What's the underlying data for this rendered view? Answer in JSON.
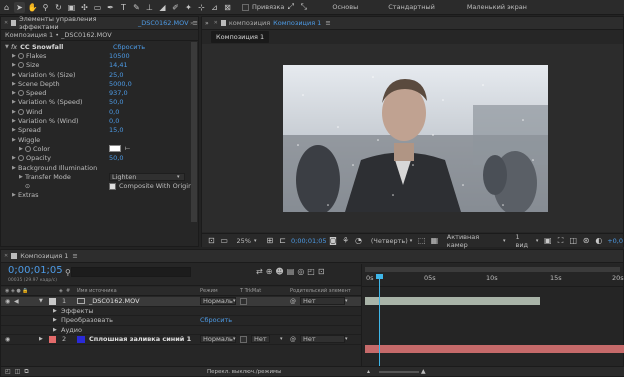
{
  "toolbar": {
    "snap_label": "Привязка",
    "workspaces": [
      "Основы",
      "Стандартный",
      "Маленький экран"
    ]
  },
  "effects_panel": {
    "tab_label": "Элементы управления эффектами",
    "tab_file": "_DSC0162.MOV",
    "breadcrumb": "Композиция 1 • _DSC0162.MOV",
    "effect_name": "CC Snowfall",
    "reset_label": "Сбросить",
    "props": [
      {
        "label": "Flakes",
        "value": "10500",
        "indent": 1,
        "stopwatch": true
      },
      {
        "label": "Size",
        "value": "14,41",
        "indent": 1,
        "stopwatch": true
      },
      {
        "label": "Variation % (Size)",
        "value": "25,0",
        "indent": 1,
        "stopwatch": false
      },
      {
        "label": "Scene Depth",
        "value": "5000,0",
        "indent": 1,
        "stopwatch": false
      },
      {
        "label": "Speed",
        "value": "937,0",
        "indent": 1,
        "stopwatch": true
      },
      {
        "label": "Variation % (Speed)",
        "value": "50,0",
        "indent": 1,
        "stopwatch": false
      },
      {
        "label": "Wind",
        "value": "0,0",
        "indent": 1,
        "stopwatch": true
      },
      {
        "label": "Variation % (Wind)",
        "value": "0,0",
        "indent": 1,
        "stopwatch": false
      },
      {
        "label": "Spread",
        "value": "15,0",
        "indent": 1,
        "stopwatch": false
      },
      {
        "label": "Wiggle",
        "value": "",
        "indent": 1,
        "stopwatch": false
      },
      {
        "label": "Color",
        "value": "",
        "indent": 2,
        "stopwatch": true
      },
      {
        "label": "Opacity",
        "value": "50,0",
        "indent": 1,
        "stopwatch": true
      },
      {
        "label": "Background Illumination",
        "value": "",
        "indent": 1,
        "stopwatch": false
      },
      {
        "label": "Transfer Mode",
        "value": "",
        "indent": 2,
        "stopwatch": false
      },
      {
        "label": "",
        "value": "",
        "indent": 2,
        "stopwatch": false
      },
      {
        "label": "Extras",
        "value": "",
        "indent": 1,
        "stopwatch": false
      }
    ],
    "transfer_mode_value": "Lighten",
    "composite_label": "Composite With Origina"
  },
  "comp_panel": {
    "tab_label": "композиция",
    "tab_name": "Композиция 1",
    "subtab": "Композиция 1",
    "footer": {
      "zoom": "25%",
      "time": "0;00;01;05",
      "quality": "(Четверть)",
      "camera": "Активная камер",
      "views": "1 вид",
      "exposure": "+0,0"
    }
  },
  "timeline": {
    "tab_label": "Композиция 1",
    "timecode": "0;00;01;05",
    "fps_note": "00035 (29.97 кадр/с)",
    "headers": {
      "source": "Имя источника",
      "mode": "Режим",
      "trkmat": "T TrkMat",
      "parent": "Родительский элемент"
    },
    "ruler": [
      "0s",
      "05s",
      "10s",
      "15s",
      "20s"
    ],
    "layers": [
      {
        "num": "1",
        "name": "_DSC0162.MOV",
        "mode": "Нормаль",
        "trk": "",
        "parent": "Нет",
        "color": "#c9c9c9"
      },
      {
        "num": "2",
        "name": "Сплошная заливка синий 1",
        "mode": "Нормаль",
        "trk": "Нет",
        "parent": "Нет",
        "color": "#2a2ad8"
      }
    ],
    "subrows": [
      {
        "label": "Эффекты"
      },
      {
        "label": "Преобразовать",
        "value": "Сбросить"
      },
      {
        "label": "Аудио"
      }
    ],
    "footer_label": "Перекл. выключ./режимы"
  }
}
